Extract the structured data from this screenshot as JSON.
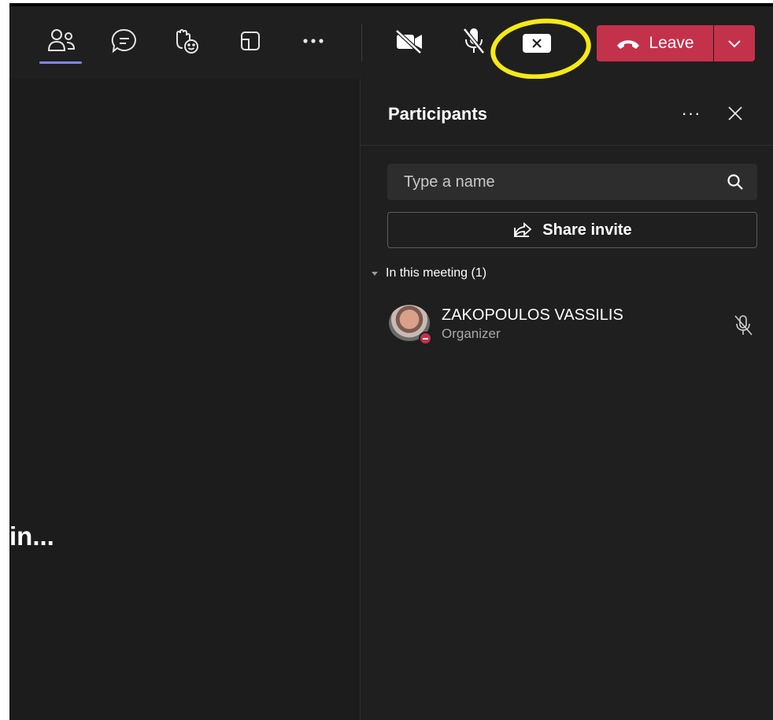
{
  "toolbar": {
    "items": [
      {
        "name": "people-icon",
        "active": true
      },
      {
        "name": "chat-icon"
      },
      {
        "name": "react-raise-hand-icon"
      },
      {
        "name": "rooms-icon"
      },
      {
        "name": "more-actions-icon"
      },
      {
        "name": "camera-off-icon"
      },
      {
        "name": "mic-off-icon"
      },
      {
        "name": "stop-sharing-icon"
      }
    ],
    "leave_label": "Leave",
    "accent_color": "#c4314b",
    "active_indicator_color": "#7f85f5",
    "highlight_color": "#f5ea14"
  },
  "stage": {
    "text": "in..."
  },
  "panel": {
    "title": "Participants",
    "more_label": "···",
    "search": {
      "placeholder": "Type a name"
    },
    "share_invite_label": "Share invite",
    "section_label": "In this meeting (1)",
    "participants": [
      {
        "name": "ZAKOPOULOS VASSILIS",
        "role": "Organizer",
        "status": "busy",
        "mic": "muted"
      }
    ]
  }
}
